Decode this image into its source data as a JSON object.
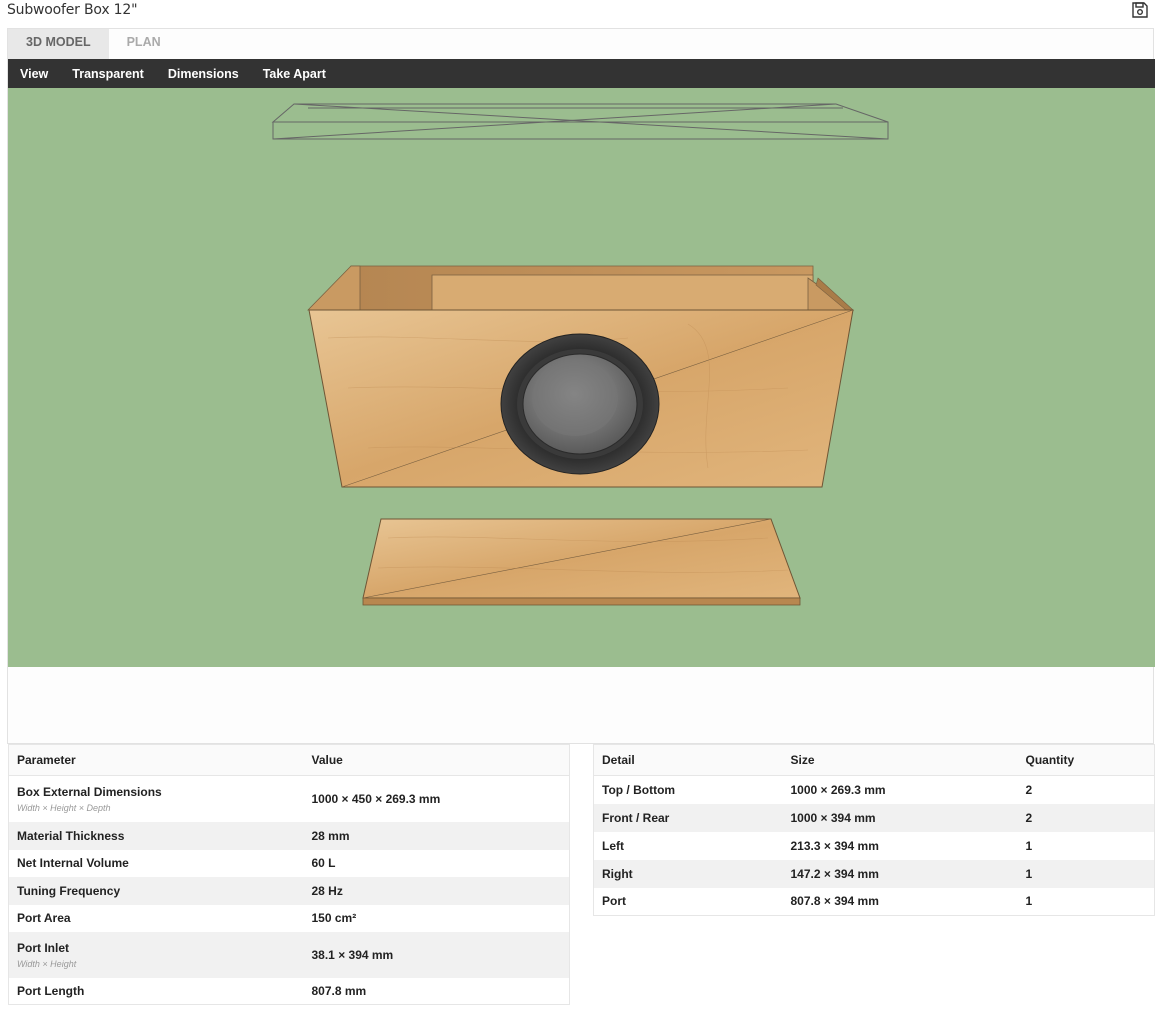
{
  "page": {
    "title": "Subwoofer Box 12\""
  },
  "icons": {
    "save": "save-icon"
  },
  "tabs": [
    {
      "label": "3D MODEL",
      "active": true
    },
    {
      "label": "PLAN",
      "active": false
    }
  ],
  "toolbar": {
    "items": [
      "View",
      "Transparent",
      "Dimensions",
      "Take Apart"
    ]
  },
  "colors": {
    "viewport_bg": "#9bbd8f",
    "toolbar_bg": "#333333",
    "wood": "#d9a86b"
  },
  "params_table": {
    "headers": [
      "Parameter",
      "Value"
    ],
    "rows": [
      {
        "label": "Box External Dimensions",
        "sub": "Width × Height × Depth",
        "value": "1000 × 450 × 269.3 mm"
      },
      {
        "label": "Material Thickness",
        "sub": "",
        "value": "28 mm"
      },
      {
        "label": "Net Internal Volume",
        "sub": "",
        "value": "60 L"
      },
      {
        "label": "Tuning Frequency",
        "sub": "",
        "value": "28 Hz"
      },
      {
        "label": "Port Area",
        "sub": "",
        "value": "150 cm²"
      },
      {
        "label": "Port Inlet",
        "sub": "Width × Height",
        "value": "38.1 × 394 mm"
      },
      {
        "label": "Port Length",
        "sub": "",
        "value": "807.8 mm"
      }
    ]
  },
  "details_table": {
    "headers": [
      "Detail",
      "Size",
      "Quantity"
    ],
    "rows": [
      {
        "detail": "Top / Bottom",
        "size": "1000 × 269.3 mm",
        "qty": "2"
      },
      {
        "detail": "Front / Rear",
        "size": "1000 × 394 mm",
        "qty": "2"
      },
      {
        "detail": "Left",
        "size": "213.3 × 394 mm",
        "qty": "1"
      },
      {
        "detail": "Right",
        "size": "147.2 × 394 mm",
        "qty": "1"
      },
      {
        "detail": "Port",
        "size": "807.8 × 394 mm",
        "qty": "1"
      }
    ]
  }
}
